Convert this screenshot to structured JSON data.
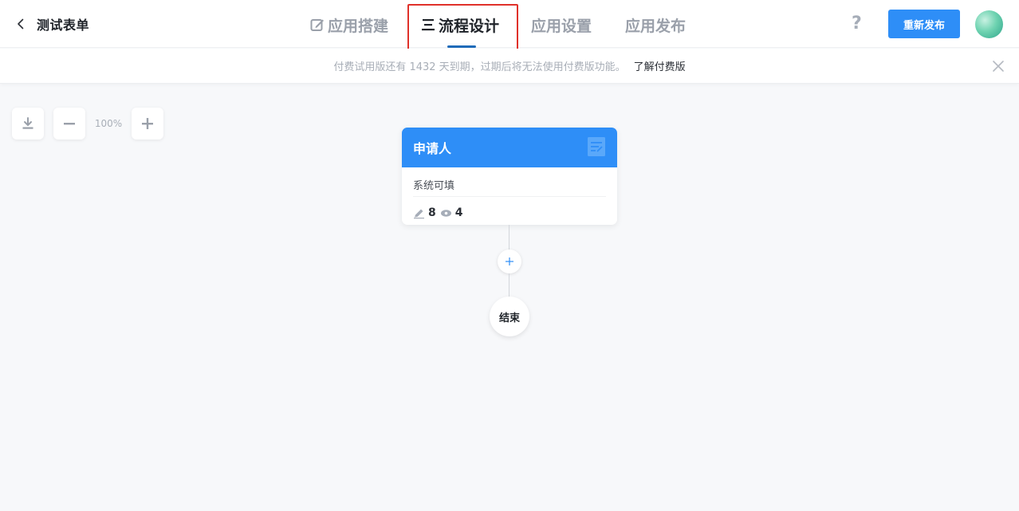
{
  "header": {
    "back_title": "测试表单",
    "tabs": [
      {
        "label": "应用搭建",
        "icon": "edit-icon",
        "active": false
      },
      {
        "label": "流程设计",
        "icon": "flow-icon",
        "active": true
      },
      {
        "label": "应用设置",
        "icon": "",
        "active": false
      },
      {
        "label": "应用发布",
        "icon": "",
        "active": false
      }
    ],
    "help_icon": "?",
    "publish_label": "重新发布"
  },
  "banner": {
    "text": "付费试用版还有 1432 天到期，过期后将无法使用付费版功能。",
    "link_label": "了解付费版"
  },
  "toolbar": {
    "zoom_level": "100%"
  },
  "flow": {
    "start_node": {
      "title": "申请人",
      "field_label": "系统可填",
      "edit_count": "8",
      "view_count": "4"
    },
    "end_node": {
      "label": "结束"
    }
  },
  "colors": {
    "accent": "#2e8ef7",
    "highlight_box": "#e0312a",
    "active_underline": "#1f6bb9"
  }
}
